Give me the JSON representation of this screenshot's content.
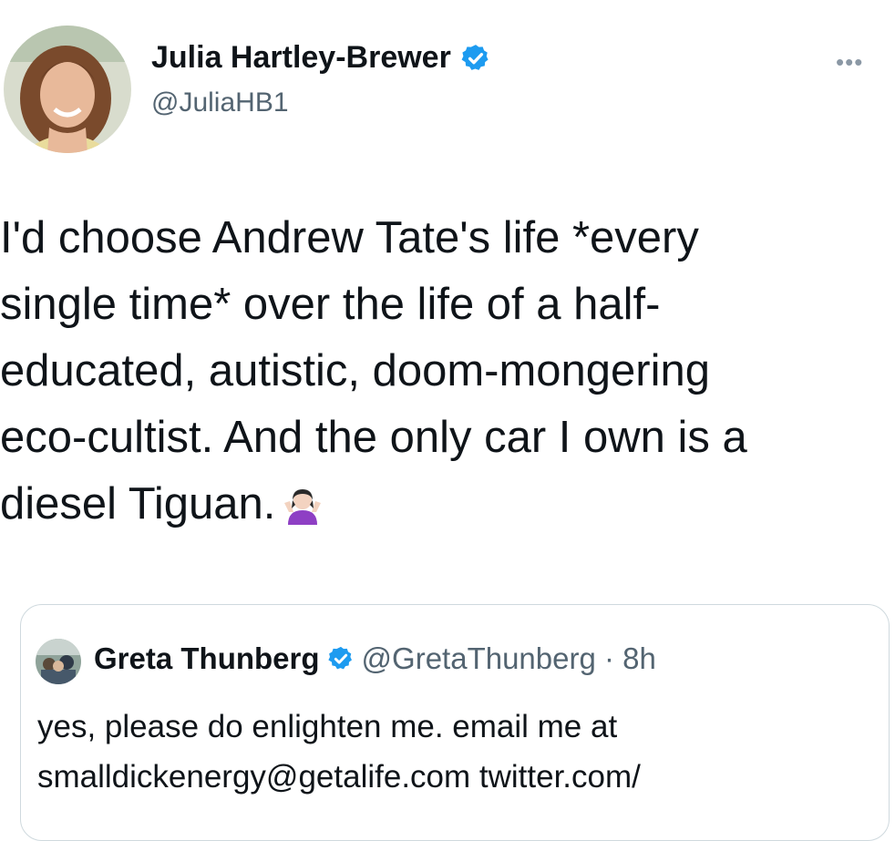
{
  "tweet": {
    "author": {
      "name": "Julia Hartley-Brewer",
      "handle": "@JuliaHB1"
    },
    "more_icon": "•••",
    "text_lines": [
      "I'd choose Andrew Tate's life *every",
      "single time* over the life of a half-",
      "educated, autistic, doom-mongering",
      "eco-cultist. And the only car I own is a",
      "diesel Tiguan."
    ],
    "emoji": "shrugging-woman-emoji"
  },
  "quoted": {
    "name": "Greta Thunberg",
    "handle_time": "@GretaThunberg · 8h",
    "text_lines": [
      "yes, please do enlighten me. email me at",
      "smalldickenergy@getalife.com twitter.com/"
    ]
  },
  "colors": {
    "verified": "#1d9bf0",
    "secondary_text": "#536471",
    "border": "#cfd9de"
  }
}
